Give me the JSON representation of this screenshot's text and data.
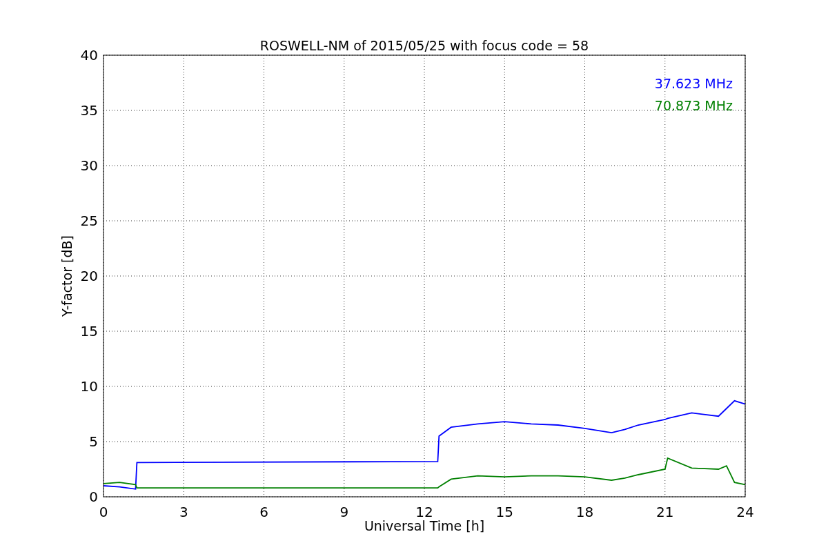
{
  "figure": {
    "chart_data": {
      "type": "line",
      "title": "ROSWELL-NM of 2015/05/25 with focus code = 58",
      "xlabel": "Universal Time [h]",
      "ylabel": "Y-factor [dB]",
      "x": [
        0,
        0.6,
        1.2,
        1.25,
        12.5,
        12.55,
        13,
        14,
        15,
        16,
        17,
        18,
        19,
        19.5,
        20,
        21,
        21.1,
        22,
        23,
        23.3,
        23.6,
        24
      ],
      "series": [
        {
          "name": "37.623 MHz",
          "color": "#0000ff",
          "values": [
            1.0,
            0.9,
            0.7,
            3.1,
            3.2,
            5.5,
            6.3,
            6.6,
            6.8,
            6.6,
            6.5,
            6.2,
            5.8,
            6.1,
            6.5,
            7.0,
            7.1,
            7.6,
            7.3,
            8.0,
            8.7,
            8.4
          ]
        },
        {
          "name": "70.873 MHz",
          "color": "#008000",
          "values": [
            1.2,
            1.3,
            1.1,
            0.8,
            0.8,
            0.9,
            1.6,
            1.9,
            1.8,
            1.9,
            1.9,
            1.8,
            1.5,
            1.7,
            2.0,
            2.5,
            3.5,
            2.6,
            2.5,
            2.8,
            1.3,
            1.1
          ]
        }
      ],
      "xlim": [
        0,
        24
      ],
      "ylim": [
        0,
        40
      ],
      "xticks": [
        0,
        3,
        6,
        9,
        12,
        15,
        18,
        21,
        24
      ],
      "yticks": [
        0,
        5,
        10,
        15,
        20,
        25,
        30,
        35,
        40
      ],
      "grid": true
    }
  }
}
